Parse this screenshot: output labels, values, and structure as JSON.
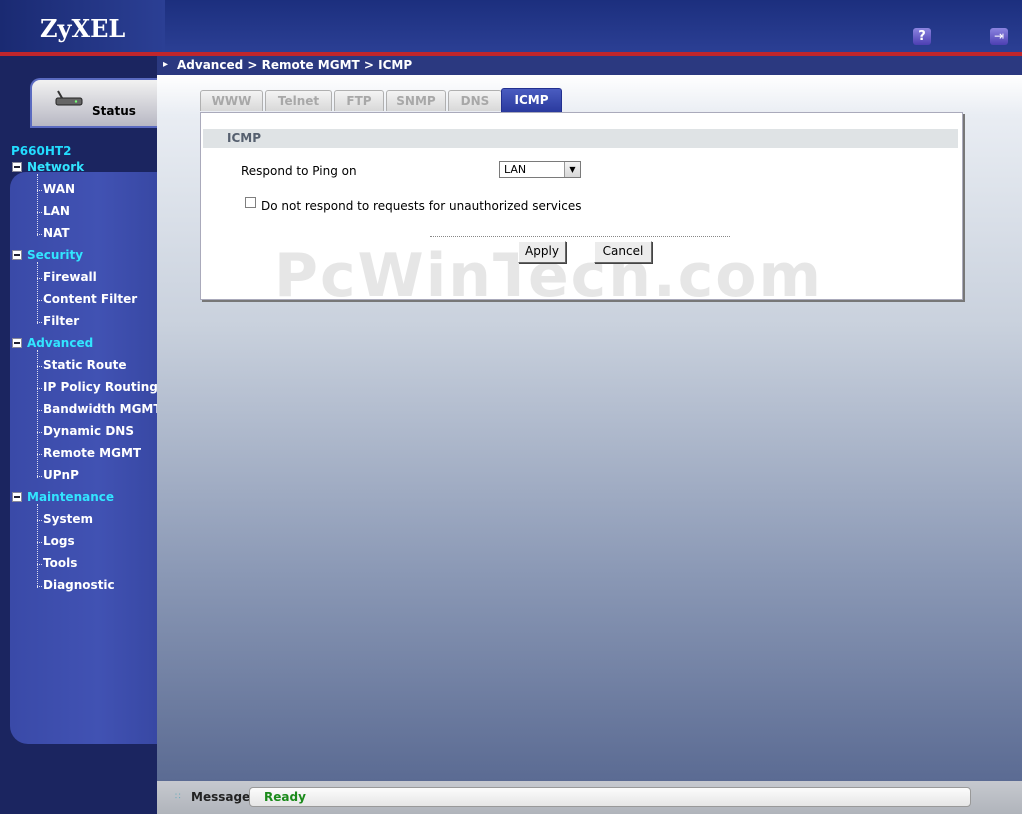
{
  "header": {
    "logo": "ZyXEL",
    "help_icon": "question-icon",
    "logout_icon": "logout-icon"
  },
  "breadcrumb": "Advanced > Remote MGMT > ICMP",
  "sidebar": {
    "status_label": "Status",
    "model": "P660HT2",
    "sections": [
      {
        "label": "Network",
        "items": [
          "WAN",
          "LAN",
          "NAT"
        ]
      },
      {
        "label": "Security",
        "items": [
          "Firewall",
          "Content Filter",
          "Filter"
        ]
      },
      {
        "label": "Advanced",
        "items": [
          "Static Route",
          "IP Policy Routing",
          "Bandwidth MGMT",
          "Dynamic DNS",
          "Remote MGMT",
          "UPnP"
        ]
      },
      {
        "label": "Maintenance",
        "items": [
          "System",
          "Logs",
          "Tools",
          "Diagnostic"
        ]
      }
    ]
  },
  "tabs": [
    {
      "label": "WWW",
      "active": false
    },
    {
      "label": "Telnet",
      "active": false
    },
    {
      "label": "FTP",
      "active": false
    },
    {
      "label": "SNMP",
      "active": false
    },
    {
      "label": "DNS",
      "active": false
    },
    {
      "label": "ICMP",
      "active": true
    }
  ],
  "form": {
    "section_title": "ICMP",
    "ping_label": "Respond to Ping on",
    "ping_value": "LAN",
    "checkbox_label": "Do not respond to requests for unauthorized services",
    "checkbox_checked": false,
    "apply_label": "Apply",
    "cancel_label": "Cancel"
  },
  "watermark": "PcWinTech.com",
  "status_bar": {
    "label": "Message",
    "text": "Ready",
    "text_color": "#1a8a1a"
  },
  "colors": {
    "header_blue": "#2b3f94",
    "accent_red": "#c0262c",
    "nav_section": "#32e5ff"
  }
}
